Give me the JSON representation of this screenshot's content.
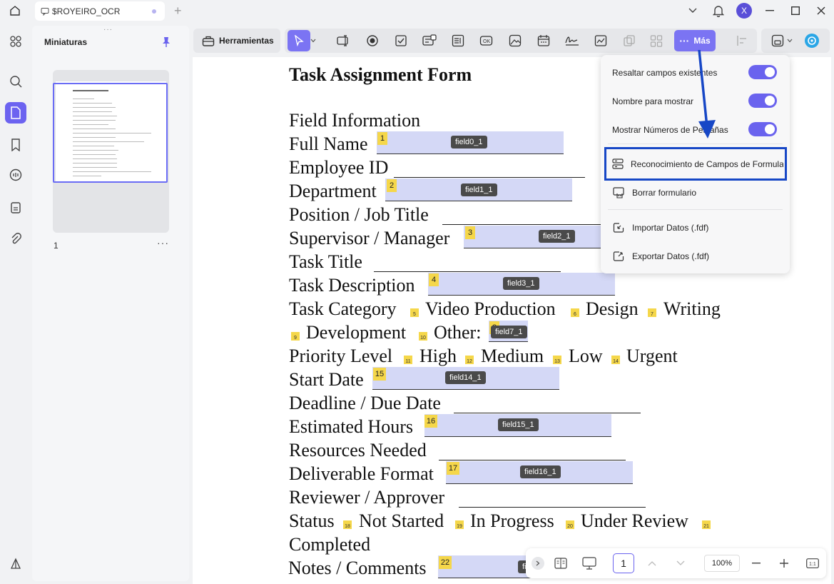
{
  "window": {
    "tab_title": "$ROYEIRO_OCR",
    "avatar_letter": "X"
  },
  "sidebar": {
    "panel_title": "Miniaturas",
    "page_number": "1",
    "more": "···"
  },
  "toolbar": {
    "tools_label": "Herramientas",
    "more_label": "Más",
    "more_dots": "···",
    "accent_color": "#7b74f3"
  },
  "document": {
    "title": "Task Assignment Form",
    "section": "Field Information",
    "lines": {
      "full_name": "Full Name",
      "employee_id": "Employee ID",
      "department": "Department",
      "position": "Position / Job Title",
      "supervisor": "Supervisor / Manager",
      "task_title": "Task Title",
      "task_description": "Task Description",
      "task_category": "Task Category",
      "video_production": "Video Production",
      "design": "Design",
      "writing": "Writing",
      "development": "Development",
      "other": "Other:",
      "priority_level": "Priority Level",
      "high": "High",
      "medium": "Medium",
      "low": "Low",
      "urgent": "Urgent",
      "start_date": "Start Date",
      "deadline": "Deadline / Due Date",
      "estimated_hours": "Estimated Hours",
      "resources": "Resources Needed",
      "deliverable": "Deliverable Format",
      "reviewer": "Reviewer / Approver",
      "status": "Status",
      "not_started": "Not Started",
      "in_progress": "In Progress",
      "under_review": "Under Review",
      "completed": "Completed",
      "notes": "Notes / Comments"
    },
    "fields": [
      {
        "num": "1",
        "label": "field0_1"
      },
      {
        "num": "2",
        "label": "field1_1"
      },
      {
        "num": "3",
        "label": "field2_1"
      },
      {
        "num": "4",
        "label": "field3_1"
      },
      {
        "num": "8",
        "label": "field7_1"
      },
      {
        "num": "15",
        "label": "field14_1"
      },
      {
        "num": "16",
        "label": "field15_1"
      },
      {
        "num": "17",
        "label": "field16_1"
      },
      {
        "num": "22",
        "label": "fi"
      }
    ],
    "checkboxes": [
      "5",
      "6",
      "7",
      "9",
      "10",
      "11",
      "12",
      "13",
      "14",
      "18",
      "19",
      "20",
      "21"
    ]
  },
  "menu": {
    "toggle_highlight": "Resaltar campos existentes",
    "toggle_names": "Nombre para mostrar",
    "toggle_tab_numbers": "Mostrar Números de Pestañas",
    "recognize": "Reconocimiento de Campos de Formulario",
    "clear_form": "Borrar formulario",
    "import_data": "Importar Datos (.fdf)",
    "export_data": "Exportar Datos (.fdf)"
  },
  "bottom_nav": {
    "page": "1",
    "zoom": "100%"
  }
}
